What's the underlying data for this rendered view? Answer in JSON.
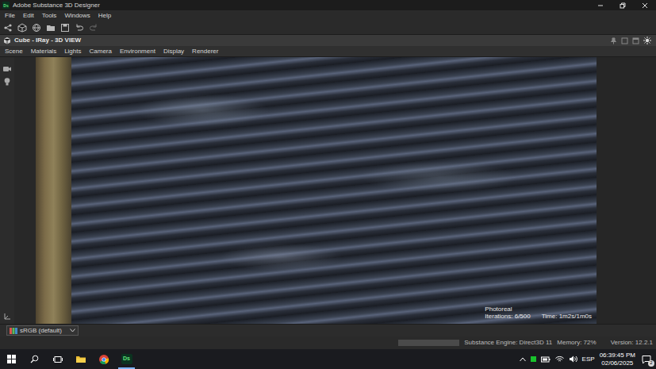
{
  "window": {
    "title": "Adobe Substance 3D Designer",
    "app_icon": "Ds"
  },
  "menu": [
    "File",
    "Edit",
    "Tools",
    "Windows",
    "Help"
  ],
  "panel": {
    "title": "Cube - IRay - 3D VIEW",
    "menu": [
      "Scene",
      "Materials",
      "Lights",
      "Camera",
      "Environment",
      "Display",
      "Renderer"
    ]
  },
  "viewport": {
    "mode": "Photoreal",
    "iterations": "Iterations: 6/500",
    "time": "Time: 1m2s/1m0s"
  },
  "color_space": {
    "value": "sRGB (default)"
  },
  "status_bar": {
    "progress": {
      "level": 0
    },
    "engine": "Substance Engine: Direct3D 11",
    "memory": "Memory: 72%",
    "version": "Version: 12.2.1"
  },
  "taskbar": {
    "apps": [
      {
        "kind": "explorer",
        "selected": false
      },
      {
        "kind": "chrome",
        "selected": false
      },
      {
        "kind": "designer",
        "label": "Ds",
        "selected": true
      }
    ],
    "language": "ESP",
    "time": "06:39:45 PM",
    "date": "02/06/2025",
    "notifications": "2"
  }
}
